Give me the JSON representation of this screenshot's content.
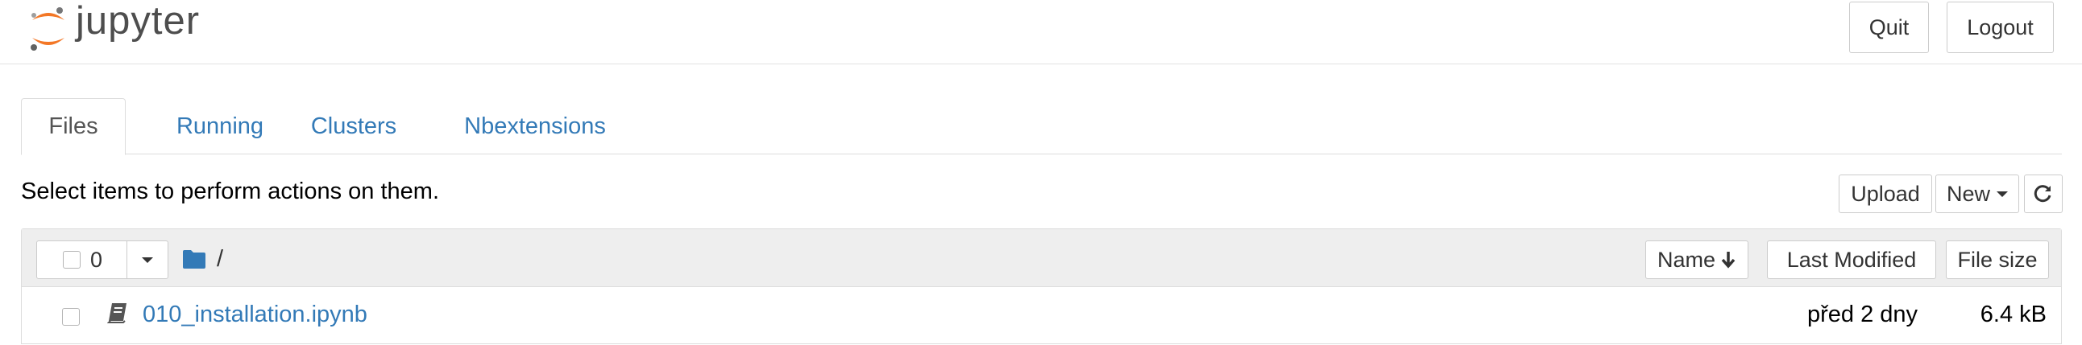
{
  "header": {
    "logo_text": "jupyter",
    "quit_label": "Quit",
    "logout_label": "Logout"
  },
  "tabs": [
    {
      "label": "Files",
      "active": true
    },
    {
      "label": "Running",
      "active": false
    },
    {
      "label": "Clusters",
      "active": false
    },
    {
      "label": "Nbextensions",
      "active": false
    }
  ],
  "toolbar": {
    "hint": "Select items to perform actions on them.",
    "upload_label": "Upload",
    "new_label": "New",
    "refresh_icon": "refresh-icon"
  },
  "list": {
    "selected_count": "0",
    "breadcrumb_sep": "/",
    "columns": {
      "name": "Name",
      "last_modified": "Last Modified",
      "file_size": "File size"
    },
    "rows": [
      {
        "name": "010_installation.ipynb",
        "modified": "před 2 dny",
        "size": "6.4 kB",
        "icon": "notebook-icon"
      }
    ]
  },
  "colors": {
    "link": "#337ab7",
    "logo_orange": "#f37726",
    "logo_gray": "#4e4e4e",
    "header_bg": "#eeeeee"
  }
}
